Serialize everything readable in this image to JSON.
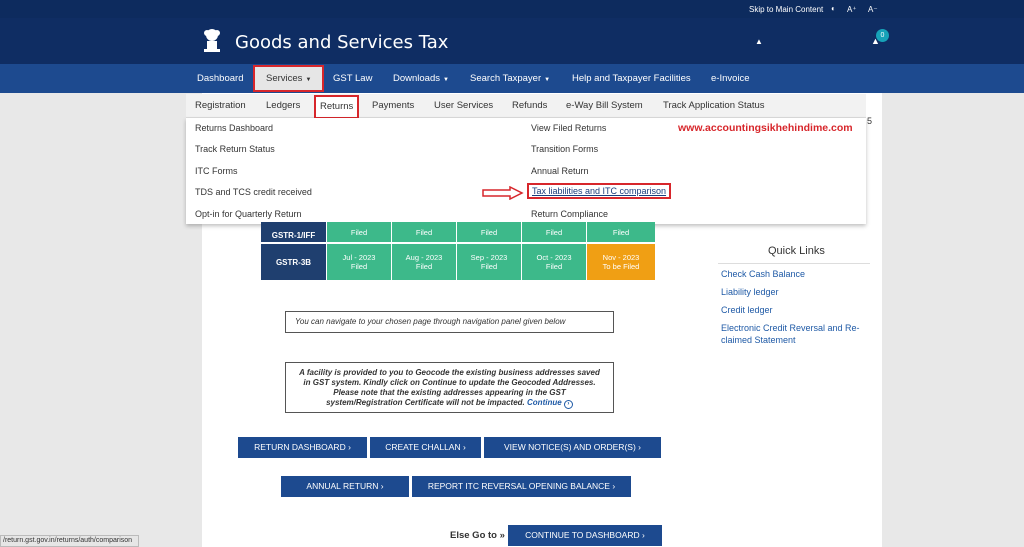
{
  "topbar": {
    "skip_link": "Skip to Main Content",
    "contrast_icon": "contrast-icon",
    "font_increase": "A⁺",
    "font_decrease": "A⁻"
  },
  "header": {
    "title": "Goods and Services Tax",
    "user_icon": "user-icon",
    "bell_icon": "bell-icon",
    "notification_count": "0"
  },
  "mainnav": {
    "items": [
      {
        "label": "Dashboard"
      },
      {
        "label": "Services"
      },
      {
        "label": "GST Law"
      },
      {
        "label": "Downloads"
      },
      {
        "label": "Search Taxpayer"
      },
      {
        "label": "Help and Taxpayer Facilities"
      },
      {
        "label": "e-Invoice"
      }
    ]
  },
  "subnav": {
    "items": [
      {
        "label": "Registration"
      },
      {
        "label": "Ledgers"
      },
      {
        "label": "Returns"
      },
      {
        "label": "Payments"
      },
      {
        "label": "User Services"
      },
      {
        "label": "Refunds"
      },
      {
        "label": "e-Way Bill System"
      },
      {
        "label": "Track Application Status"
      }
    ]
  },
  "dropdown": {
    "left": [
      {
        "label": "Returns Dashboard"
      },
      {
        "label": "Track Return Status"
      },
      {
        "label": "ITC Forms"
      },
      {
        "label": "TDS and TCS credit received"
      },
      {
        "label": "Opt-in for Quarterly Return"
      }
    ],
    "right": [
      {
        "label": "View Filed Returns"
      },
      {
        "label": "Transition Forms"
      },
      {
        "label": "Annual Return"
      },
      {
        "label": "Tax liabilities and ITC comparison"
      },
      {
        "label": "Return Compliance"
      }
    ]
  },
  "watermark": "www.accountingsikhehindime.com",
  "partial_digit": "5",
  "status": {
    "row1": {
      "label": "GSTR-1/IFF",
      "cells": [
        "Filed",
        "Filed",
        "Filed",
        "Filed",
        "Filed"
      ]
    },
    "row2": {
      "label": "GSTR-3B",
      "cells": [
        {
          "period": "Jul - 2023",
          "status": "Filed"
        },
        {
          "period": "Aug - 2023",
          "status": "Filed"
        },
        {
          "period": "Sep - 2023",
          "status": "Filed"
        },
        {
          "period": "Oct - 2023",
          "status": "Filed"
        },
        {
          "period": "Nov - 2023",
          "status": "To be Filed"
        }
      ]
    },
    "colors": {
      "filed": "#3db98a",
      "pending": "#f09f14",
      "label": "#1f3f6f"
    }
  },
  "quick_links": {
    "title": "Quick Links",
    "links": [
      "Check Cash Balance",
      "Liability ledger",
      "Credit ledger",
      "Electronic Credit Reversal and Re-claimed Statement"
    ]
  },
  "info": {
    "nav_hint": "You can navigate to your chosen page through navigation panel given below",
    "geocode_text": "A facility is provided to you to Geocode the existing business addresses saved in GST system. Kindly click on Continue to update the Geocoded Addresses. Please note that the existing addresses appearing in the GST system/Registration Certificate will not be impacted.",
    "continue_label": "Continue"
  },
  "buttons": {
    "return_dashboard": "RETURN DASHBOARD ›",
    "create_challan": "CREATE CHALLAN ›",
    "view_notices": "VIEW NOTICE(S) AND ORDER(S) ›",
    "annual_return": "ANNUAL RETURN ›",
    "report_itc": "REPORT ITC REVERSAL OPENING BALANCE ›",
    "continue_dashboard": "CONTINUE TO DASHBOARD ›"
  },
  "else_go": "Else Go to »",
  "status_bar_url": "/return.gst.gov.in/returns/auth/comparison",
  "accent_colors": {
    "navy": "#0f2d63",
    "nav": "#1d4a8f",
    "highlight": "#d7262b"
  }
}
